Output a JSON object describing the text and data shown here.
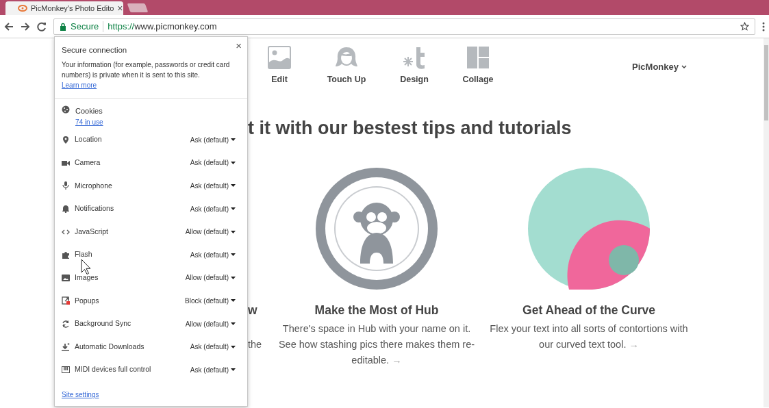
{
  "browser": {
    "tab": {
      "title": "PicMonkey's Photo Edito",
      "close": "×"
    },
    "address": {
      "security": "Secure",
      "scheme": "https://",
      "host": "www.picmonkey.com"
    }
  },
  "page": {
    "nav": [
      {
        "label": "Edit"
      },
      {
        "label": "Touch Up"
      },
      {
        "label": "Design"
      },
      {
        "label": "Collage"
      }
    ],
    "account": "PicMonkey",
    "headline": "t it with our bestest tips and tutorials",
    "partial_card": {
      "title": "w",
      "text": "the"
    },
    "cards": [
      {
        "title": "Make the Most of Hub",
        "text": "There's space in Hub with your name on it. See how stashing pics there makes them re-editable.",
        "arrow": "→"
      },
      {
        "title": "Get Ahead of the Curve",
        "text": "Flex your text into all sorts of contortions with our curved text tool.",
        "arrow": "→"
      }
    ]
  },
  "site_info_popup": {
    "close": "×",
    "title": "Secure connection",
    "description": "Your information (for example, passwords or credit card numbers) is private when it is sent to this site.",
    "learn_more": "Learn more",
    "cookies": {
      "label": "Cookies",
      "link": "74 in use"
    },
    "permissions": [
      {
        "label": "Location",
        "value": "Ask (default)"
      },
      {
        "label": "Camera",
        "value": "Ask (default)"
      },
      {
        "label": "Microphone",
        "value": "Ask (default)"
      },
      {
        "label": "Notifications",
        "value": "Ask (default)"
      },
      {
        "label": "JavaScript",
        "value": "Allow (default)"
      },
      {
        "label": "Flash",
        "value": "Ask (default)"
      },
      {
        "label": "Images",
        "value": "Allow (default)"
      },
      {
        "label": "Popups",
        "value": "Block (default)"
      },
      {
        "label": "Background Sync",
        "value": "Allow (default)"
      },
      {
        "label": "Automatic Downloads",
        "value": "Ask (default)"
      },
      {
        "label": "MIDI devices full control",
        "value": "Ask (default)"
      }
    ],
    "site_settings": "Site settings"
  }
}
